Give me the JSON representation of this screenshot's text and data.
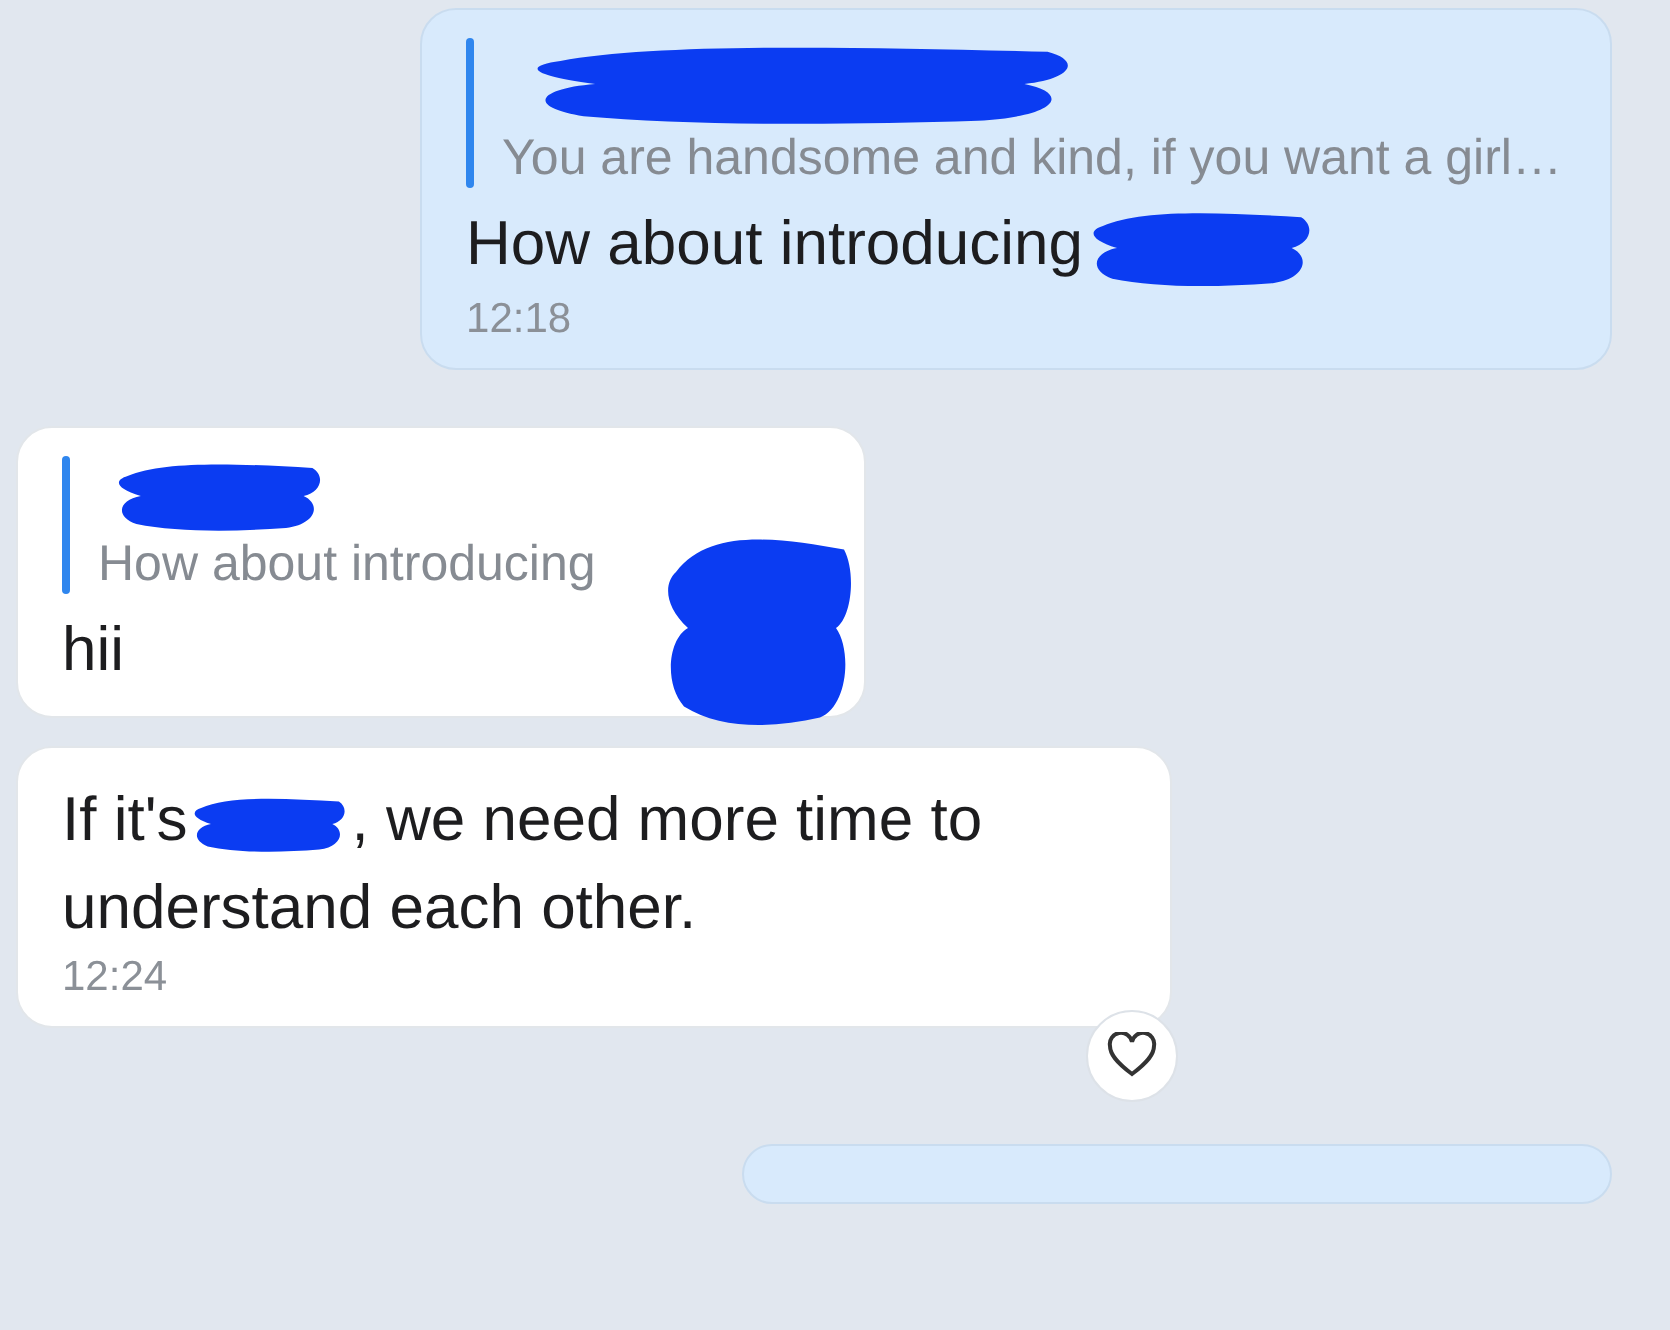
{
  "messages": [
    {
      "kind": "outgoing",
      "quote": {
        "sender_redacted": true,
        "text": "You are handsome and kind, if you want a girl…"
      },
      "parts": [
        {
          "kind": "text",
          "text": "How about introducing"
        },
        {
          "kind": "redaction"
        }
      ],
      "time": "12:18"
    },
    {
      "kind": "incoming",
      "quote": {
        "sender_redacted": true,
        "text": "How about introducing",
        "end_redacted": true
      },
      "parts": [
        {
          "kind": "text",
          "text": "hii"
        }
      ]
    },
    {
      "kind": "incoming",
      "parts": [
        {
          "kind": "text",
          "text": "If it's"
        },
        {
          "kind": "redaction"
        },
        {
          "kind": "text",
          "text": ", we need more time to understand each other."
        }
      ],
      "time": "12:24",
      "reaction": {
        "kind": "heart"
      }
    },
    {
      "kind": "outgoing"
    }
  ]
}
